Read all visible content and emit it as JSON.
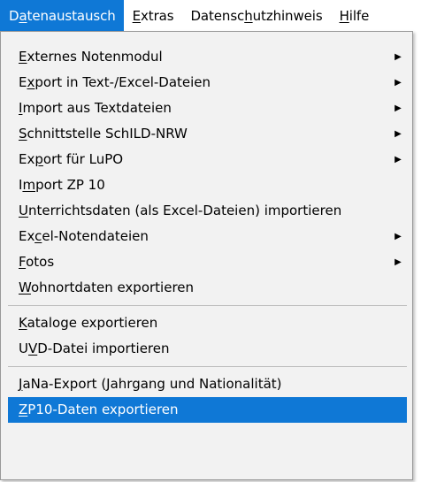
{
  "menubar": {
    "items": [
      {
        "label": "Datenaustausch",
        "active": true
      },
      {
        "label": "Extras",
        "active": false
      },
      {
        "label": "Datenschutzhinweis",
        "active": false
      },
      {
        "label": "Hilfe",
        "active": false
      }
    ]
  },
  "dropdown": {
    "groups": [
      [
        {
          "label": "Externes Notenmodul",
          "mnemonic_index": 0,
          "submenu": true
        },
        {
          "label": "Export in Text-/Excel-Dateien",
          "mnemonic_index": 1,
          "submenu": true
        },
        {
          "label": "Import aus Textdateien",
          "mnemonic_index": 0,
          "submenu": true
        },
        {
          "label": "Schnittstelle SchILD-NRW",
          "mnemonic_index": 0,
          "submenu": true
        },
        {
          "label": "Export für LuPO",
          "mnemonic_index": 2,
          "submenu": true
        },
        {
          "label": "Import ZP 10",
          "mnemonic_index": 1,
          "submenu": false
        },
        {
          "label": "Unterrichtsdaten (als Excel-Dateien) importieren",
          "mnemonic_index": 0,
          "submenu": false
        },
        {
          "label": "Excel-Notendateien",
          "mnemonic_index": 2,
          "submenu": true
        },
        {
          "label": "Fotos",
          "mnemonic_index": 0,
          "submenu": true
        },
        {
          "label": "Wohnortdaten exportieren",
          "mnemonic_index": 0,
          "submenu": false
        }
      ],
      [
        {
          "label": "Kataloge exportieren",
          "mnemonic_index": 0,
          "submenu": false
        },
        {
          "label": "UVD-Datei importieren",
          "mnemonic_index": 1,
          "submenu": false
        }
      ],
      [
        {
          "label": "JaNa-Export (Jahrgang und Nationalität)",
          "mnemonic_index": 0,
          "submenu": false
        },
        {
          "label": "ZP10-Daten exportieren",
          "mnemonic_index": 0,
          "submenu": false,
          "highlighted": true
        }
      ]
    ]
  },
  "icons": {
    "submenu_arrow": "triangle-right-icon",
    "submenu_arrow_glyph": "▶"
  },
  "colors": {
    "accent": "#0f78d6",
    "menu_background": "#f2f2f2",
    "separator": "#bdbdbd",
    "highlight_text": "#ffffff"
  }
}
